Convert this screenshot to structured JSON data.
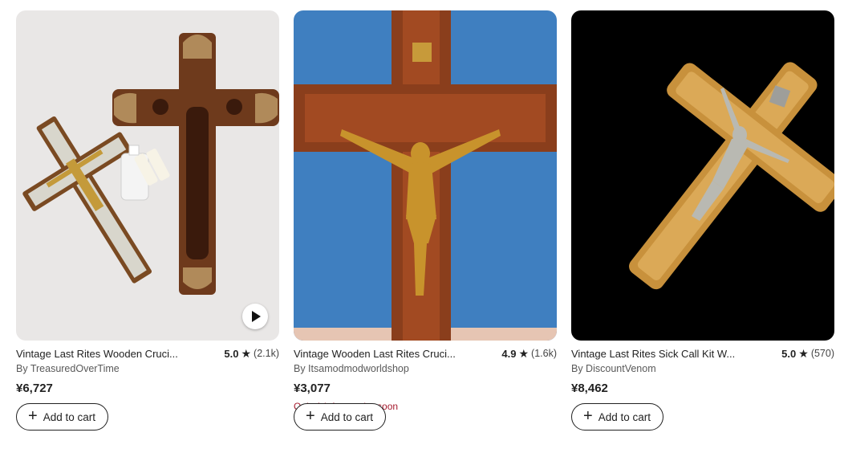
{
  "listings": [
    {
      "title": "Vintage Last Rites Wooden Cruci...",
      "rating": "5.0",
      "reviews": "(2.1k)",
      "shop": "By TreasuredOverTime",
      "price": "¥6,727",
      "stock_note": "",
      "button_label": "Add to cart",
      "has_video": true
    },
    {
      "title": "Vintage Wooden Last Rites Cruci...",
      "rating": "4.9",
      "reviews": "(1.6k)",
      "shop": "By Itsamodmodworldshop",
      "price": "¥3,077",
      "stock_note": "Only 1 left — order soon",
      "button_label": "Add to cart",
      "has_video": false
    },
    {
      "title": "Vintage Last Rites Sick Call Kit W...",
      "rating": "5.0",
      "reviews": "(570)",
      "shop": "By DiscountVenom",
      "price": "¥8,462",
      "stock_note": "",
      "button_label": "Add to cart",
      "has_video": false
    }
  ],
  "colors": {
    "text": "#222222",
    "muted": "#595959",
    "stock_warning": "#a61a2e"
  }
}
